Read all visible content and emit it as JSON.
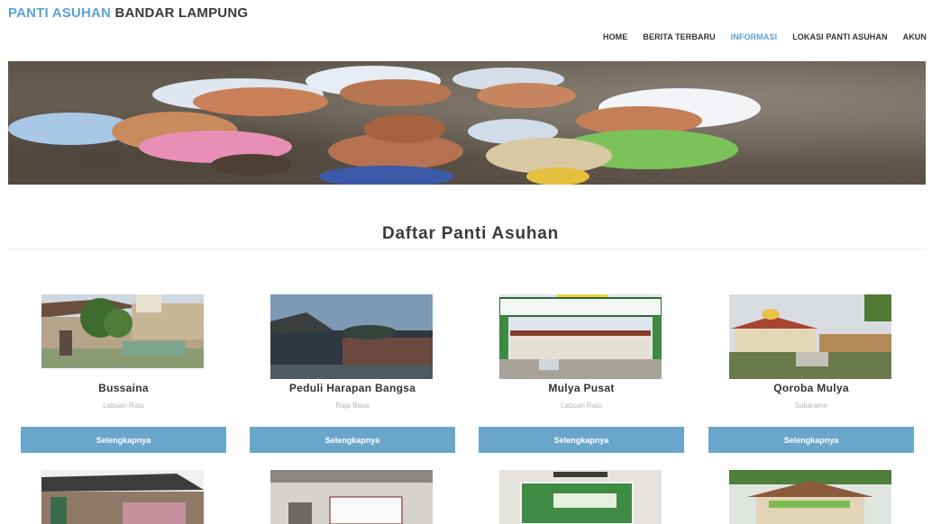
{
  "brand": {
    "accent": "PANTI ASUHAN",
    "rest": "BANDAR LAMPUNG"
  },
  "nav": {
    "items": [
      {
        "label": "HOME",
        "active": false
      },
      {
        "label": "BERITA TERBARU",
        "active": false
      },
      {
        "label": "INFORMASI",
        "active": true
      },
      {
        "label": "LOKASI PANTI ASUHAN",
        "active": false
      },
      {
        "label": "AKUN",
        "active": false
      }
    ]
  },
  "section": {
    "title": "Daftar Panti Asuhan"
  },
  "orphanages": [
    {
      "name": "Bussaina",
      "location": "Labuan Ratu",
      "button": "Selengkapnya"
    },
    {
      "name": "Peduli Harapan Bangsa",
      "location": "Raja Basa",
      "button": "Selengkapnya"
    },
    {
      "name": "Mulya Pusat",
      "location": "Labuan Ratu",
      "button": "Selengkapnya"
    },
    {
      "name": "Qoroba Mulya",
      "location": "Sukarame",
      "button": "Selengkapnya"
    }
  ],
  "colors": {
    "accent": "#5aa3d6",
    "button": "#6aa6cc"
  }
}
